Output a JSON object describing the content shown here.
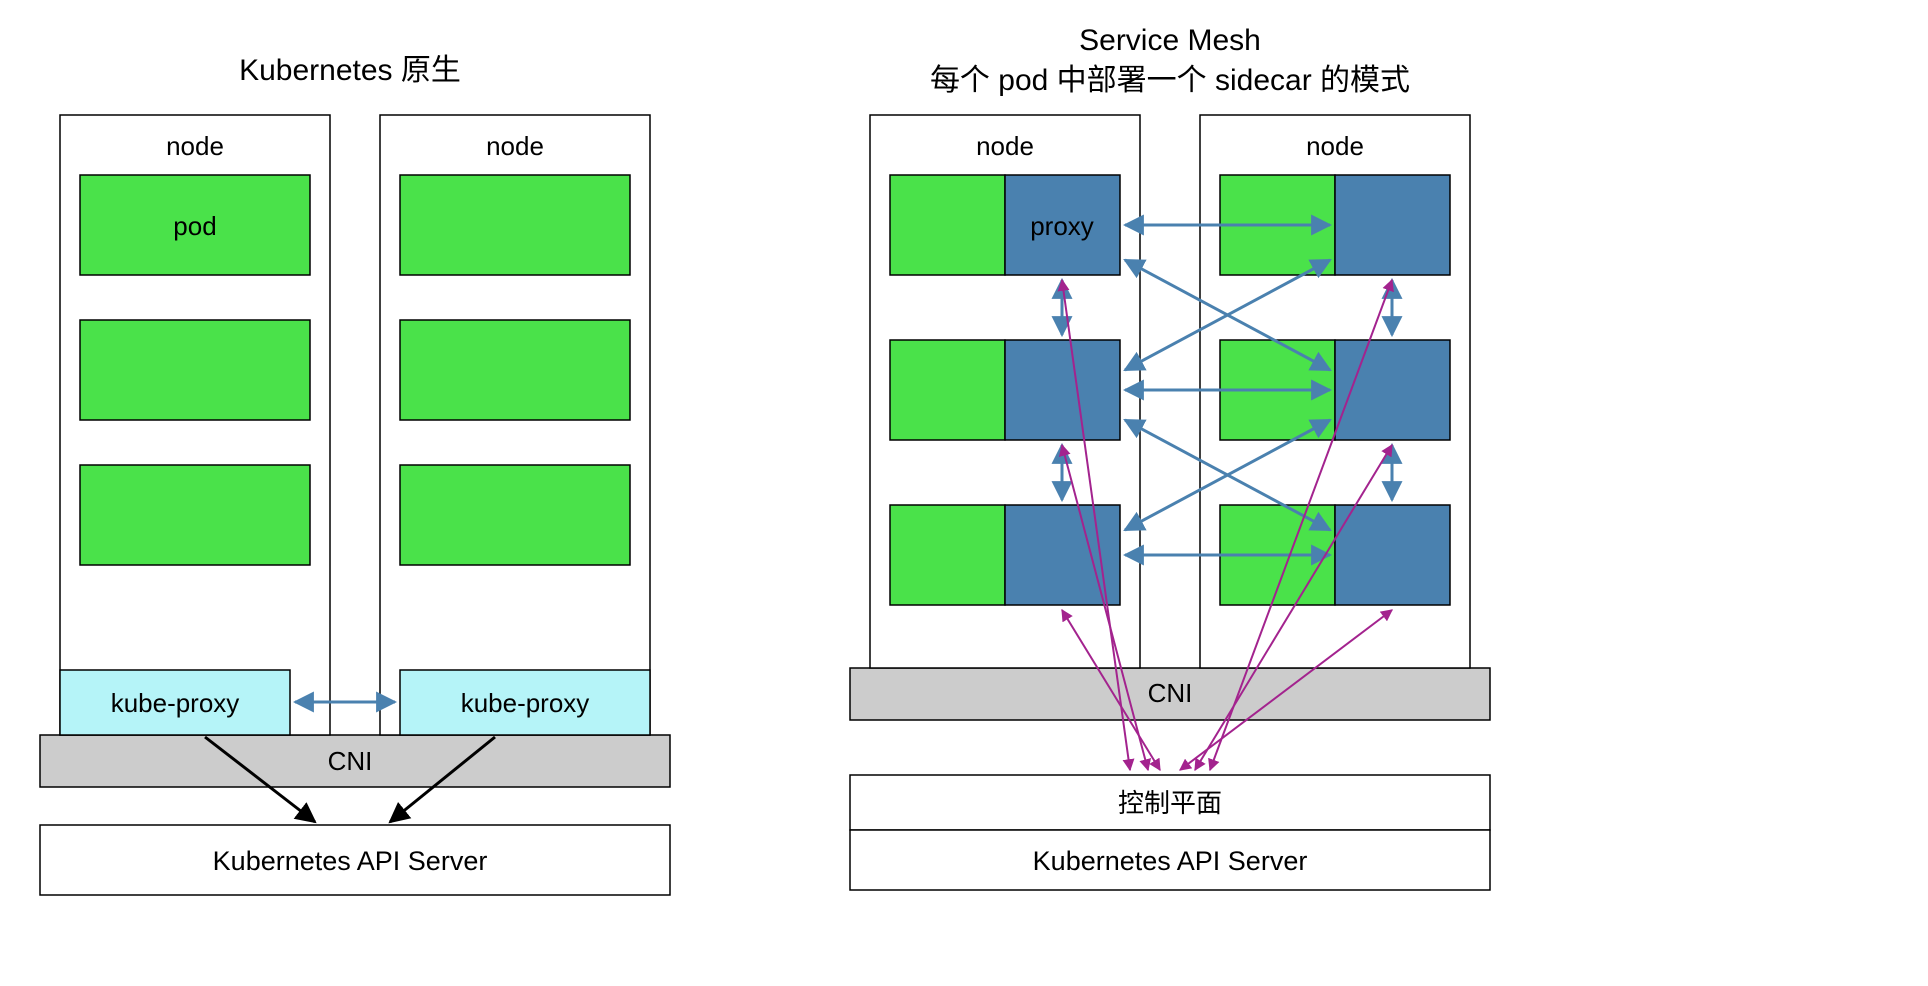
{
  "left": {
    "title": "Kubernetes 原生",
    "node_label": "node",
    "pod_label": "pod",
    "kube_proxy_label": "kube-proxy",
    "cni_label": "CNI",
    "api_label": "Kubernetes API Server"
  },
  "right": {
    "title_line1": "Service Mesh",
    "title_line2": "每个 pod 中部署一个 sidecar 的模式",
    "node_label": "node",
    "proxy_label": "proxy",
    "cni_label": "CNI",
    "control_plane_label": "控制平面",
    "api_label": "Kubernetes API Server"
  }
}
